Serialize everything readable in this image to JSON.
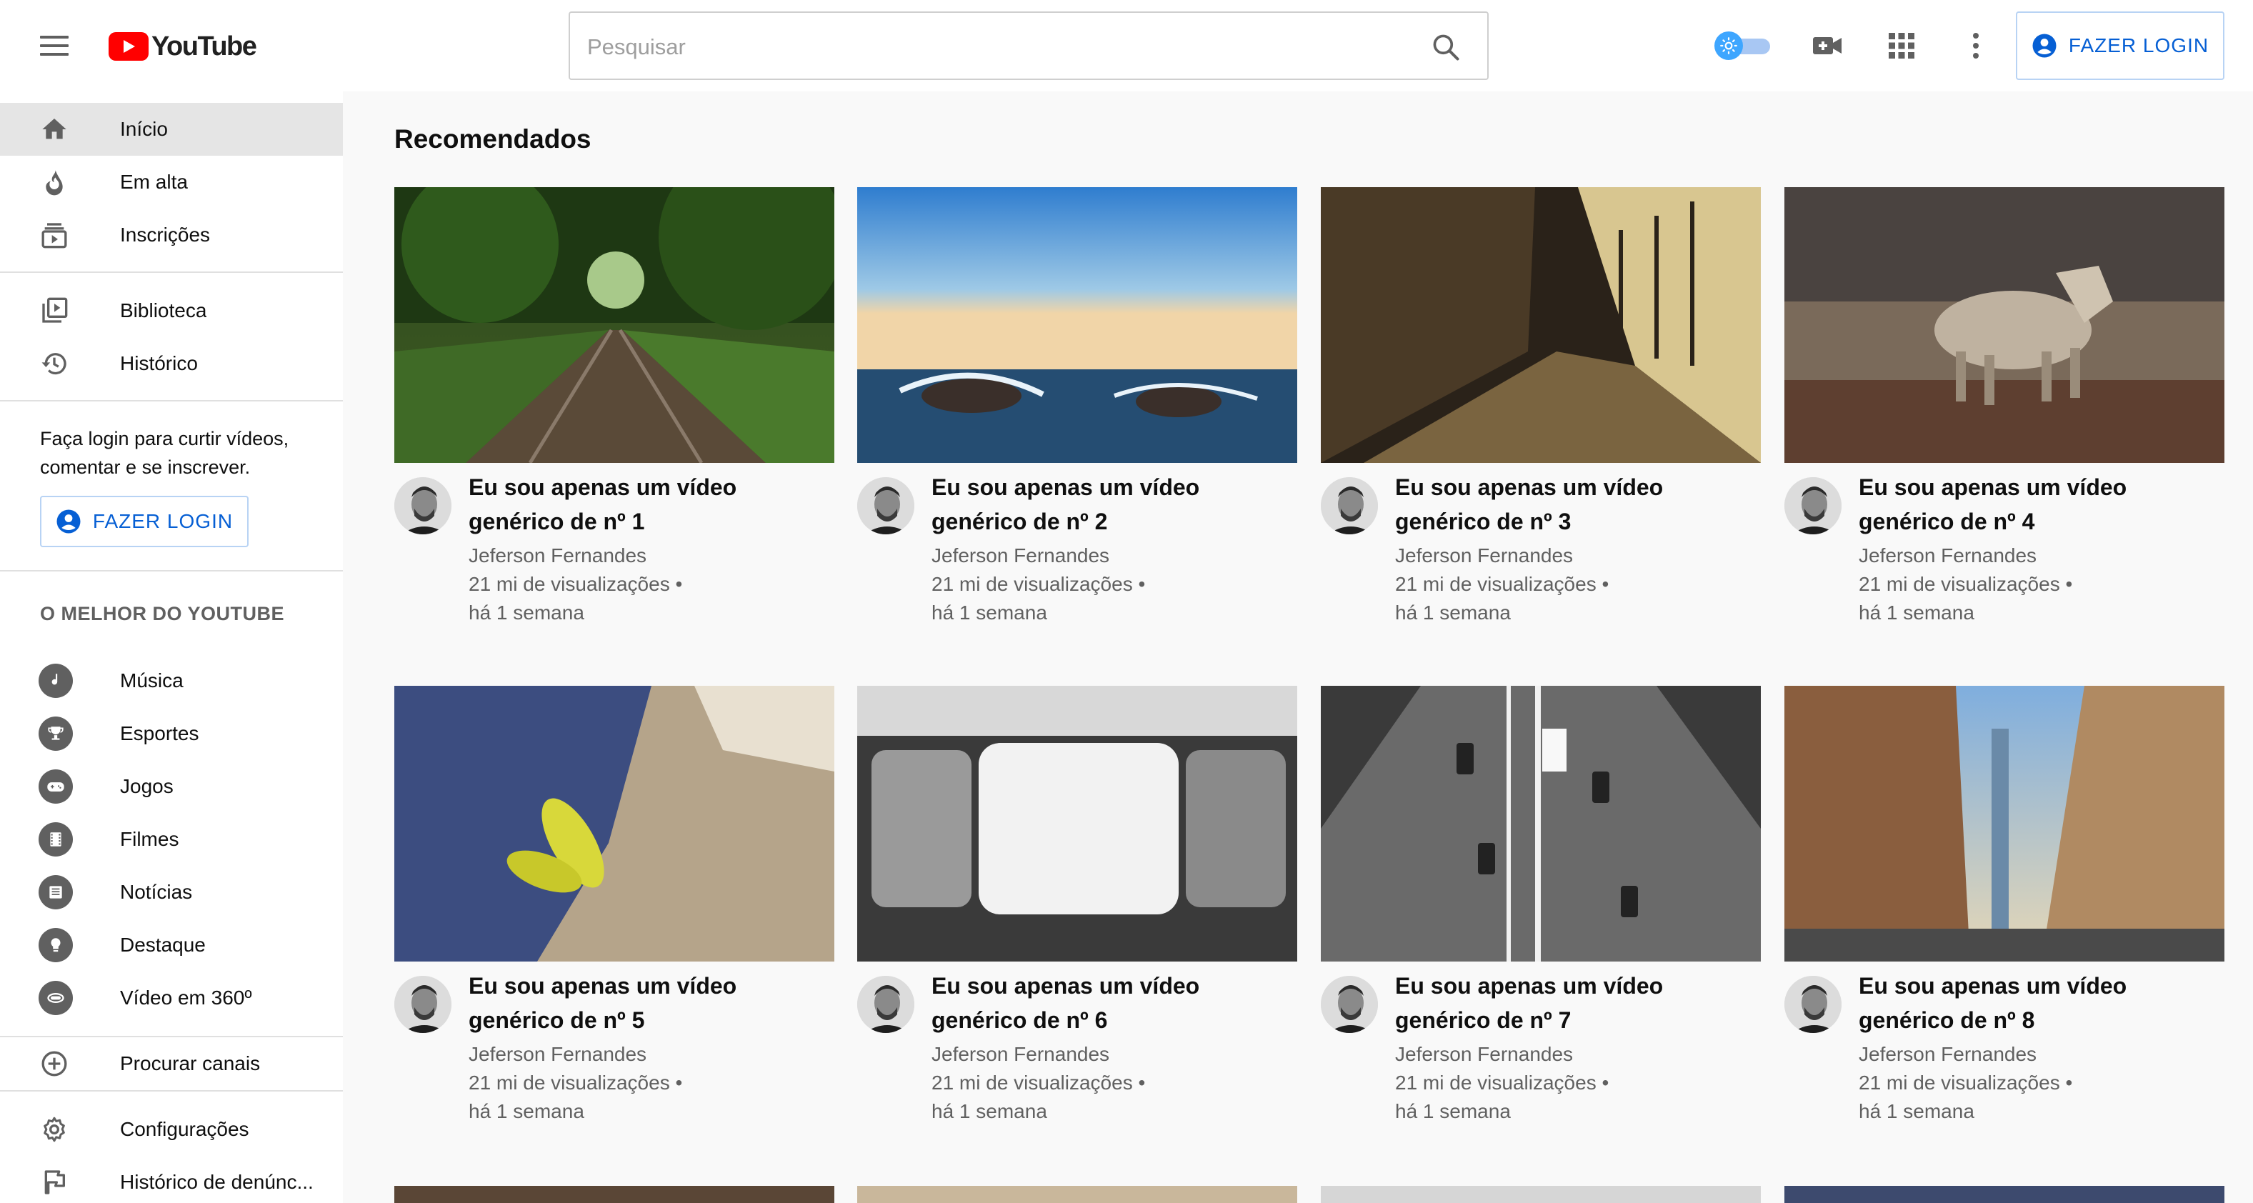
{
  "header": {
    "logo_text": "YouTube",
    "search_placeholder": "Pesquisar",
    "login_label": "FAZER LOGIN",
    "icons": [
      "menu-icon",
      "search-icon",
      "theme-toggle",
      "video-camera-icon",
      "apps-grid-icon",
      "more-vert-icon",
      "account-circle-icon"
    ]
  },
  "sidebar": {
    "primary": [
      {
        "label": "Início",
        "icon": "home-icon",
        "active": true
      },
      {
        "label": "Em alta",
        "icon": "fire-icon"
      },
      {
        "label": "Inscrições",
        "icon": "subscriptions-icon"
      }
    ],
    "library": [
      {
        "label": "Biblioteca",
        "icon": "library-icon"
      },
      {
        "label": "Histórico",
        "icon": "history-icon"
      }
    ],
    "login_prompt": "Faça login para curtir vídeos, comentar e se inscrever.",
    "login_label": "FAZER LOGIN",
    "best_of_title": "O MELHOR DO YOUTUBE",
    "best_of": [
      {
        "label": "Música",
        "icon": "music-icon"
      },
      {
        "label": "Esportes",
        "icon": "trophy-icon"
      },
      {
        "label": "Jogos",
        "icon": "gamepad-icon"
      },
      {
        "label": "Filmes",
        "icon": "film-icon"
      },
      {
        "label": "Notícias",
        "icon": "news-icon"
      },
      {
        "label": "Destaque",
        "icon": "lightbulb-icon"
      },
      {
        "label": "Vídeo em 360º",
        "icon": "vr-360-icon"
      }
    ],
    "browse_channels": {
      "label": "Procurar canais",
      "icon": "add-circle-icon"
    },
    "settings": [
      {
        "label": "Configurações",
        "icon": "gear-icon"
      },
      {
        "label": "Histórico de denúnc...",
        "icon": "flag-icon"
      }
    ]
  },
  "main": {
    "section_title": "Recomendados",
    "videos": [
      {
        "title": "Eu sou apenas um vídeo genérico de nº 1",
        "channel": "Jeferson Fernandes",
        "views": "21 mi de visualizações •",
        "age": "há 1 semana",
        "thumb": "railway-forest"
      },
      {
        "title": "Eu sou apenas um vídeo genérico de nº 2",
        "channel": "Jeferson Fernandes",
        "views": "21 mi de visualizações •",
        "age": "há 1 semana",
        "thumb": "ocean-sunset"
      },
      {
        "title": "Eu sou apenas um vídeo genérico de nº 3",
        "channel": "Jeferson Fernandes",
        "views": "21 mi de visualizações •",
        "age": "há 1 semana",
        "thumb": "hallway-light"
      },
      {
        "title": "Eu sou apenas um vídeo genérico de nº 4",
        "channel": "Jeferson Fernandes",
        "views": "21 mi de visualizações •",
        "age": "há 1 semana",
        "thumb": "coyote"
      },
      {
        "title": "Eu sou apenas um vídeo genérico de nº 5",
        "channel": "Jeferson Fernandes",
        "views": "21 mi de visualizações •",
        "age": "há 1 semana",
        "thumb": "plant-wood"
      },
      {
        "title": "Eu sou apenas um vídeo genérico de nº 6",
        "channel": "Jeferson Fernandes",
        "views": "21 mi de visualizações •",
        "age": "há 1 semana",
        "thumb": "train-window"
      },
      {
        "title": "Eu sou apenas um vídeo genérico de nº 7",
        "channel": "Jeferson Fernandes",
        "views": "21 mi de visualizações •",
        "age": "há 1 semana",
        "thumb": "traffic-aerial"
      },
      {
        "title": "Eu sou apenas um vídeo genérico de nº 8",
        "channel": "Jeferson Fernandes",
        "views": "21 mi de visualizações •",
        "age": "há 1 semana",
        "thumb": "city-street"
      }
    ]
  }
}
